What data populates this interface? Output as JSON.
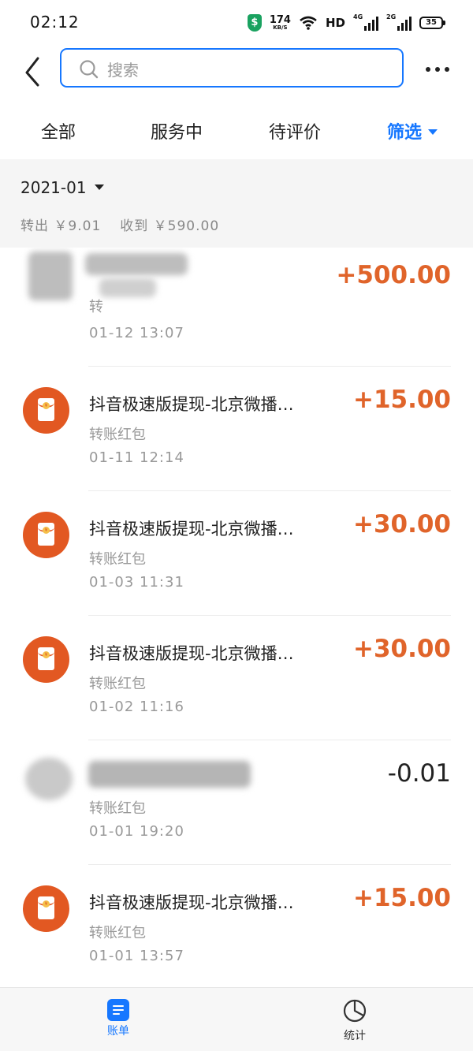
{
  "status_bar": {
    "time": "02:12",
    "net_speed": "174",
    "net_unit": "KB/S",
    "hd": "HD",
    "sig1_label": "4G",
    "sig2_label": "2G",
    "battery": "35"
  },
  "header": {
    "search_placeholder": "搜索"
  },
  "tabs": [
    "全部",
    "服务中",
    "待评价",
    "筛选"
  ],
  "month": {
    "label": "2021-01",
    "summary_out": "转出 ￥9.01",
    "summary_in": "收到 ￥590.00"
  },
  "transactions": [
    {
      "title": "",
      "subtitle": "转",
      "time": "01-12  13:07",
      "amount": "+500.00",
      "obscured": true
    },
    {
      "title": "抖音极速版提现-北京微播…",
      "subtitle": "转账红包",
      "time": "01-11  12:14",
      "amount": "+15.00"
    },
    {
      "title": "抖音极速版提现-北京微播…",
      "subtitle": "转账红包",
      "time": "01-03  11:31",
      "amount": "+30.00"
    },
    {
      "title": "抖音极速版提现-北京微播…",
      "subtitle": "转账红包",
      "time": "01-02  11:16",
      "amount": "+30.00"
    },
    {
      "title": "",
      "subtitle": "转账红包",
      "time": "01-01  19:20",
      "amount": "-0.01",
      "obscured": true
    },
    {
      "title": "抖音极速版提现-北京微播…",
      "subtitle": "转账红包",
      "time": "01-01  13:57",
      "amount": "+15.00"
    }
  ],
  "bottom_nav": {
    "bill_label": "账单",
    "stats_label": "统计"
  },
  "colors": {
    "accent": "#1677ff",
    "income": "#e0642a",
    "red_packet": "#e25822"
  }
}
